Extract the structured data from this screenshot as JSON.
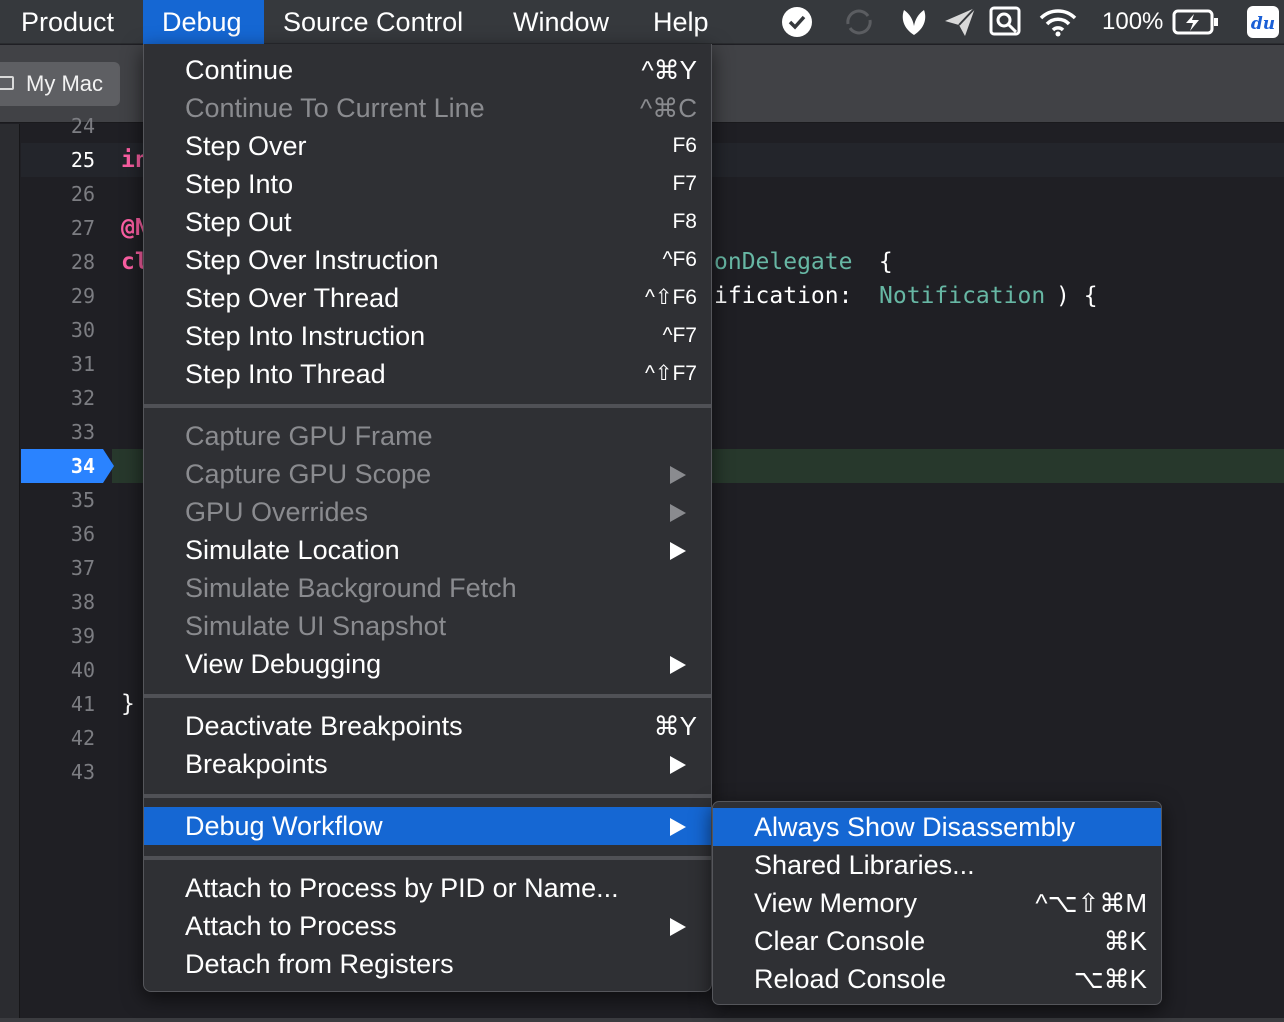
{
  "menubar": {
    "items": [
      "Product",
      "Debug",
      "Source Control",
      "Window",
      "Help"
    ],
    "active": "Debug",
    "battery": "100%"
  },
  "toolbar": {
    "scheme_label": "My Mac"
  },
  "editor": {
    "lines": [
      "24",
      "25",
      "26",
      "27",
      "28",
      "29",
      "30",
      "31",
      "32",
      "33",
      "34",
      "35",
      "36",
      "37",
      "38",
      "39",
      "40",
      "41",
      "42",
      "43"
    ],
    "current_line": "25",
    "breakpoint_line": "34",
    "code": {
      "l25": "in",
      "l27": "@N",
      "l28_left": "cl",
      "l28_right": "onDelegate",
      "l28_brace": " {",
      "l29_a": "ification: ",
      "l29_b": "Notification",
      "l29_c": ") {",
      "l41": "}"
    }
  },
  "debug_menu": {
    "continue": {
      "label": "Continue",
      "shortcut": "^⌘Y"
    },
    "continue_to_line": {
      "label": "Continue To Current Line",
      "shortcut": "^⌘C"
    },
    "step_over": {
      "label": "Step Over",
      "shortcut": "F6"
    },
    "step_into": {
      "label": "Step Into",
      "shortcut": "F7"
    },
    "step_out": {
      "label": "Step Out",
      "shortcut": "F8"
    },
    "step_over_instruction": {
      "label": "Step Over Instruction",
      "shortcut": "^F6"
    },
    "step_over_thread": {
      "label": "Step Over Thread",
      "shortcut": "^⇧F6"
    },
    "step_into_instruction": {
      "label": "Step Into Instruction",
      "shortcut": "^F7"
    },
    "step_into_thread": {
      "label": "Step Into Thread",
      "shortcut": "^⇧F7"
    },
    "capture_gpu_frame": {
      "label": "Capture GPU Frame"
    },
    "capture_gpu_scope": {
      "label": "Capture GPU Scope"
    },
    "gpu_overrides": {
      "label": "GPU Overrides"
    },
    "simulate_location": {
      "label": "Simulate Location"
    },
    "simulate_background_fetch": {
      "label": "Simulate Background Fetch"
    },
    "simulate_ui_snapshot": {
      "label": "Simulate UI Snapshot"
    },
    "view_debugging": {
      "label": "View Debugging"
    },
    "deactivate_breakpoints": {
      "label": "Deactivate Breakpoints",
      "shortcut": "⌘Y"
    },
    "breakpoints": {
      "label": "Breakpoints"
    },
    "debug_workflow": {
      "label": "Debug Workflow"
    },
    "attach_pid": {
      "label": "Attach to Process by PID or Name..."
    },
    "attach_process": {
      "label": "Attach to Process"
    },
    "detach": {
      "label": "Detach from Registers"
    }
  },
  "workflow_submenu": {
    "always_show_disassembly": {
      "label": "Always Show Disassembly"
    },
    "shared_libraries": {
      "label": "Shared Libraries..."
    },
    "view_memory": {
      "label": "View Memory",
      "shortcut": "^⌥⇧⌘M"
    },
    "clear_console": {
      "label": "Clear Console",
      "shortcut": "⌘K"
    },
    "reload_console": {
      "label": "Reload Console",
      "shortcut": "⌥⌘K"
    }
  },
  "colors": {
    "menu_highlight": "#1567d3",
    "keyword_pink": "#fc5fa3",
    "type_teal": "#67b7a4",
    "breakpoint_blue": "#2a83ff"
  }
}
